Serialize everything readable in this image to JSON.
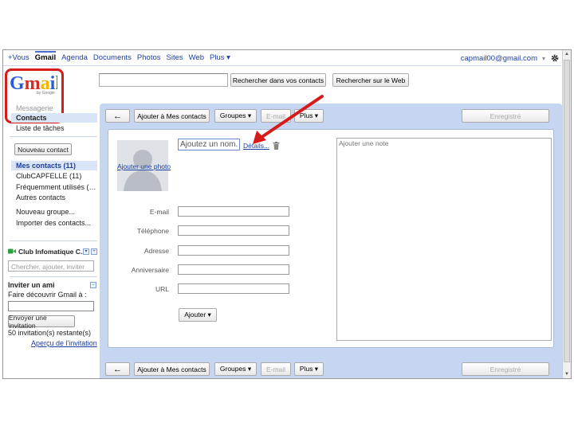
{
  "topnav": {
    "items": [
      "+Vous",
      "Gmail",
      "Agenda",
      "Documents",
      "Photos",
      "Sites",
      "Web",
      "Plus"
    ],
    "more_arrow": "▾",
    "account": "capmail00@gmail.com",
    "account_arrow": "▾",
    "gear_icon": "gear-icon"
  },
  "logo": {
    "text": "Gmail",
    "by": "by Google"
  },
  "search": {
    "contacts_button": "Rechercher dans vos contacts",
    "web_button": "Rechercher sur le Web"
  },
  "sidebar": {
    "messagerie": "Messagerie",
    "contacts": "Contacts",
    "tasks": "Liste de tâches",
    "new_contact": "Nouveau contact",
    "groups": [
      {
        "label": "Mes contacts (11)",
        "bold": true
      },
      {
        "label": "ClubCAPFELLE (11)"
      },
      {
        "label": "Fréquemment utilisés (…"
      },
      {
        "label": "Autres contacts"
      }
    ],
    "new_group": "Nouveau groupe...",
    "import": "Importer des contacts...",
    "chat": {
      "title": "Club Infomatique C...",
      "dropdown": "▾",
      "add": "+",
      "placeholder": "Chercher, ajouter, inviter"
    },
    "invite": {
      "title": "Inviter un ami",
      "collapse": "−",
      "prompt": "Faire découvrir Gmail à :",
      "button": "Envoyer une invitation",
      "remaining": "50 invitation(s) restante(s)",
      "preview": "Aperçu de l'invitation"
    }
  },
  "toolbar": {
    "back": "←",
    "add_to_contacts": "Ajouter à Mes contacts",
    "groups": "Groupes ▾",
    "email": "E-mail",
    "more": "Plus ▾",
    "saved": "Enregistré"
  },
  "contact": {
    "add_photo": "Ajouter une photo",
    "name_placeholder": "Ajoutez un nom.",
    "details": "Détails...",
    "fields": [
      "E-mail",
      "Téléphone",
      "Adresse",
      "Anniversaire",
      "URL"
    ],
    "add_button": "Ajouter ▾",
    "note": "Ajouter une note"
  },
  "colors": {
    "accent": "#1d3fa0",
    "panel": "#c6d5f0",
    "annotation": "#d61b1b"
  }
}
